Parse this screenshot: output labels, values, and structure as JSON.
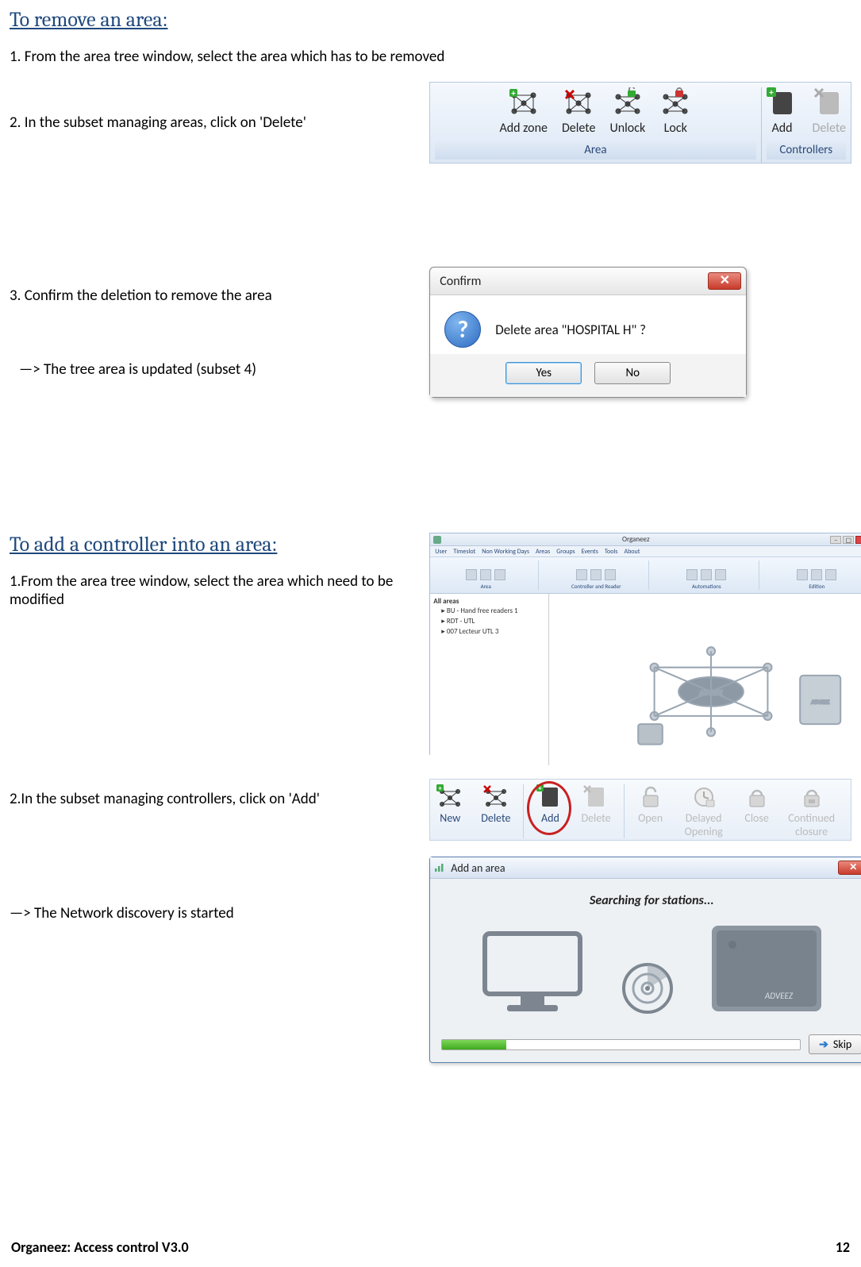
{
  "section1": {
    "heading": "To remove an area:",
    "step1": "1. From the area tree window, select the area which has to be removed",
    "step2": "2. In the subset managing areas, click on 'Delete'",
    "step3": "3.  Confirm the deletion to remove the area",
    "result": "—> The tree area is updated (subset 4)"
  },
  "ribbon": {
    "area_group_label": "Area",
    "controllers_group_label": "Controllers",
    "buttons": {
      "add_zone": "Add zone",
      "delete": "Delete",
      "unlock": "Unlock",
      "lock": "Lock",
      "add": "Add",
      "delete_ctrl": "Delete"
    }
  },
  "confirm_dialog": {
    "title": "Confirm",
    "message": "Delete area \"HOSPITAL H\" ?",
    "yes": "Yes",
    "no": "No"
  },
  "section2": {
    "heading": "To add a controller into an area:",
    "step1": "1.From the area tree window, select the area which need to be modified",
    "step2": "2.In the subset managing controllers, click on 'Add'",
    "result": "—> The Network discovery is started"
  },
  "appwindow": {
    "title": "Organeez",
    "tabs": [
      "User",
      "Timeslot",
      "Non Working Days",
      "Areas",
      "Groups",
      "Events",
      "Tools",
      "About"
    ],
    "ribbon_groups": [
      "Area",
      "Controller and Reader",
      "Automations",
      "Edition"
    ],
    "tree": {
      "root": "All areas",
      "items": [
        "BU - Hand free readers 1",
        "RDT - UTL",
        "007 Lecteur UTL 3"
      ]
    }
  },
  "toolbar2": {
    "new": "New",
    "delete": "Delete",
    "add": "Add",
    "delete2": "Delete",
    "open": "Open",
    "delayed": "Delayed Opening",
    "close": "Close",
    "continued": "Continued closure"
  },
  "add_area_dialog": {
    "title": "Add an area",
    "searching": "Searching for stations...",
    "skip": "Skip",
    "device_brand": "ADVEEZ"
  },
  "footer": {
    "left": "Organeez: Access control     V3.0",
    "page": "12"
  }
}
